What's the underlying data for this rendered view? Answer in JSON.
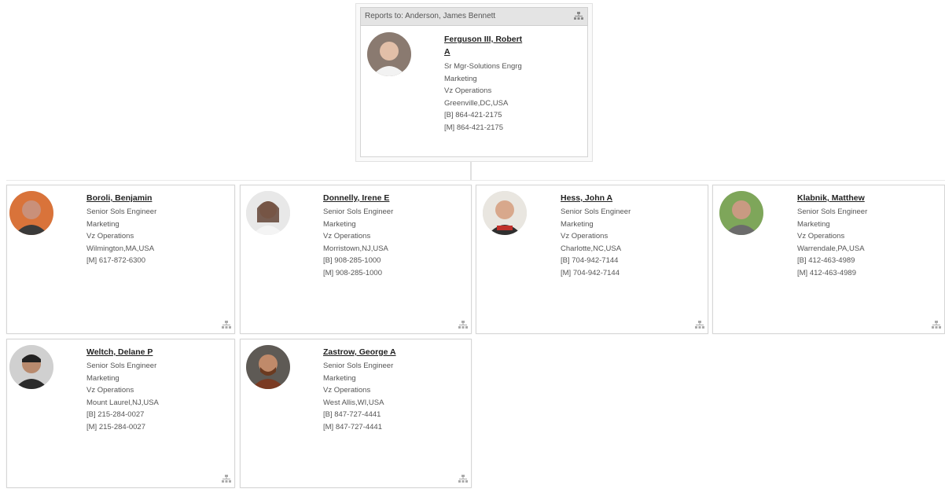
{
  "reports_to": "Reports to: Anderson, James Bennett",
  "manager": {
    "name_line1": "Ferguson III, Robert",
    "name_line2": "A",
    "lines": [
      "Sr Mgr-Solutions Engrg",
      "Marketing",
      "Vz Operations",
      "Greenville,DC,USA",
      "[B] 864-421-2175",
      "[M] 864-421-2175"
    ]
  },
  "reports": [
    {
      "name": "Boroli, Benjamin",
      "lines": [
        "Senior Sols Engineer",
        "Marketing",
        "Vz Operations",
        "Wilmington,MA,USA",
        "[M] 617-872-6300"
      ]
    },
    {
      "name": "Donnelly, Irene E",
      "lines": [
        "Senior Sols Engineer",
        "Marketing",
        "Vz Operations",
        "Morristown,NJ,USA",
        "[B] 908-285-1000",
        "[M] 908-285-1000"
      ]
    },
    {
      "name": "Hess, John A",
      "lines": [
        "Senior Sols Engineer",
        "Marketing",
        "Vz Operations",
        "Charlotte,NC,USA",
        "[B] 704-942-7144",
        "[M] 704-942-7144"
      ]
    },
    {
      "name": "Klabnik, Matthew",
      "lines": [
        "Senior Sols Engineer",
        "Marketing",
        "Vz Operations",
        "Warrendale,PA,USA",
        "[B] 412-463-4989",
        "[M] 412-463-4989"
      ]
    },
    {
      "name": "Weltch, Delane P",
      "lines": [
        "Senior Sols Engineer",
        "Marketing",
        "Vz Operations",
        "Mount Laurel,NJ,USA",
        "[B] 215-284-0027",
        "[M] 215-284-0027"
      ]
    },
    {
      "name": "Zastrow, George A",
      "lines": [
        "Senior Sols Engineer",
        "Marketing",
        "Vz Operations",
        "West Allis,WI,USA",
        "[B] 847-727-4441",
        "[M] 847-727-4441"
      ]
    }
  ],
  "icons": {
    "org_chart": "org-chart-icon"
  },
  "colors": {
    "card_border": "#d6d6d6",
    "header_bg": "#e4e4e4",
    "text": "#555555"
  }
}
